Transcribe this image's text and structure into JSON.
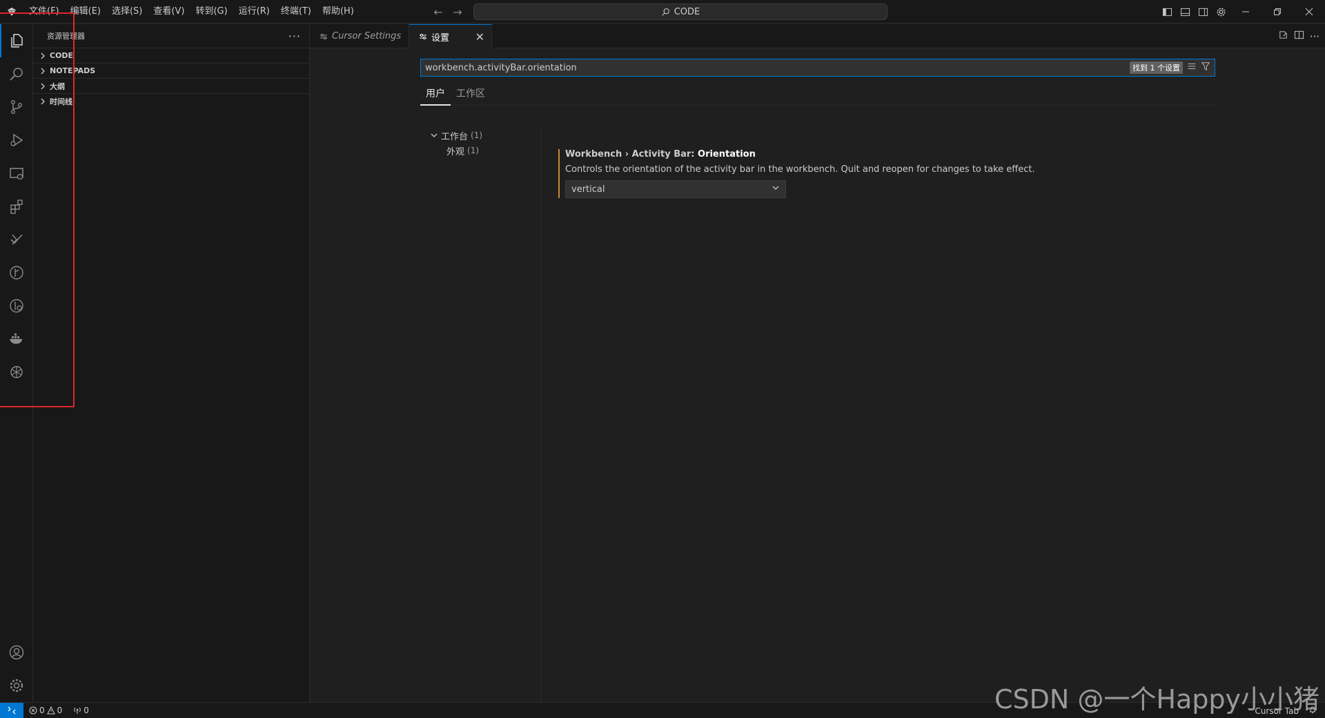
{
  "menu": [
    "文件(F)",
    "编辑(E)",
    "选择(S)",
    "查看(V)",
    "转到(G)",
    "运行(R)",
    "终端(T)",
    "帮助(H)"
  ],
  "command_center": {
    "label": "CODE"
  },
  "sidebar": {
    "title": "资源管理器",
    "sections": [
      "CODE",
      "NOTEPADS",
      "大纲",
      "时间线"
    ]
  },
  "tabs": [
    {
      "label": "Cursor Settings"
    },
    {
      "label": "设置"
    }
  ],
  "settings": {
    "search_value": "workbench.activityBar.orientation",
    "result_count": "找到 1 个设置",
    "scopes": [
      "用户",
      "工作区"
    ],
    "toc": [
      {
        "label": "工作台",
        "count": "(1)"
      },
      {
        "label": "外观",
        "count": "(1)"
      }
    ],
    "item": {
      "category": "Workbench › Activity Bar: ",
      "name": "Orientation",
      "description": "Controls the orientation of the activity bar in the workbench. Quit and reopen for changes to take effect.",
      "value": "vertical"
    }
  },
  "status": {
    "errors": "0",
    "warnings": "0",
    "ports": "0",
    "cursor_tab": "Cursor Tab"
  },
  "watermark": "CSDN @一个Happy小小猪",
  "colors": {
    "accent": "#0078d4",
    "annotation": "#e0262b",
    "modified_bar": "#c58a3a"
  }
}
